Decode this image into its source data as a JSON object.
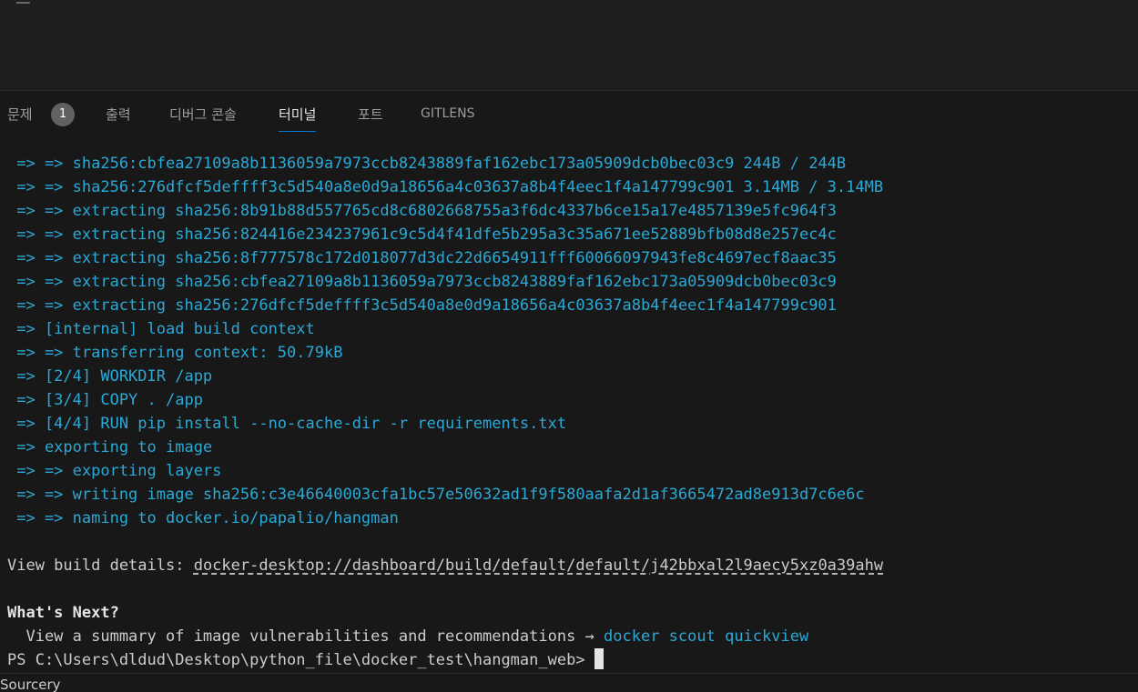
{
  "panel": {
    "tabs": [
      {
        "label": "문제",
        "active": false
      },
      {
        "label": "출력",
        "active": false
      },
      {
        "label": "디버그 콘솔",
        "active": false
      },
      {
        "label": "터미널",
        "active": true
      },
      {
        "label": "포트",
        "active": false
      },
      {
        "label": "GITLENS",
        "active": false
      }
    ],
    "problems_count": "1"
  },
  "terminal": {
    "lines": [
      " => => sha256:cbfea27109a8b1136059a7973ccb8243889faf162ebc173a05909dcb0bec03c9 244B / 244B",
      " => => sha256:276dfcf5deffff3c5d540a8e0d9a18656a4c03637a8b4f4eec1f4a147799c901 3.14MB / 3.14MB",
      " => => extracting sha256:8b91b88d557765cd8c6802668755a3f6dc4337b6ce15a17e4857139e5fc964f3",
      " => => extracting sha256:824416e234237961c9c5d4f41dfe5b295a3c35a671ee52889bfb08d8e257ec4c",
      " => => extracting sha256:8f777578c172d018077d3dc22d6654911fff60066097943fe8c4697ecf8aac35",
      " => => extracting sha256:cbfea27109a8b1136059a7973ccb8243889faf162ebc173a05909dcb0bec03c9",
      " => => extracting sha256:276dfcf5deffff3c5d540a8e0d9a18656a4c03637a8b4f4eec1f4a147799c901",
      " => [internal] load build context",
      " => => transferring context: 50.79kB",
      " => [2/4] WORKDIR /app",
      " => [3/4] COPY . /app",
      " => [4/4] RUN pip install --no-cache-dir -r requirements.txt",
      " => exporting to image",
      " => => exporting layers",
      " => => writing image sha256:c3e46640003cfa1bc57e50632ad1f9f580aafa2d1af3665472ad8e913d7c6e6c",
      " => => naming to docker.io/papalio/hangman"
    ],
    "build_details_label": "View build details: ",
    "build_details_link": "docker-desktop://dashboard/build/default/default/j42bbxal2l9aecy5xz0a39ahw",
    "whats_next": "What's Next?",
    "summary_text": "  View a summary of image vulnerabilities and recommendations → ",
    "summary_command": "docker scout quickview",
    "prompt": "PS C:\\Users\\dldud\\Desktop\\python_file\\docker_test\\hangman_web> "
  },
  "status_bar": {
    "text": "Sourcery"
  },
  "colors": {
    "background": "#181818",
    "output_cyan": "#2aa9d6",
    "text": "#cccccc",
    "active_tab_underline": "#0078d4"
  }
}
